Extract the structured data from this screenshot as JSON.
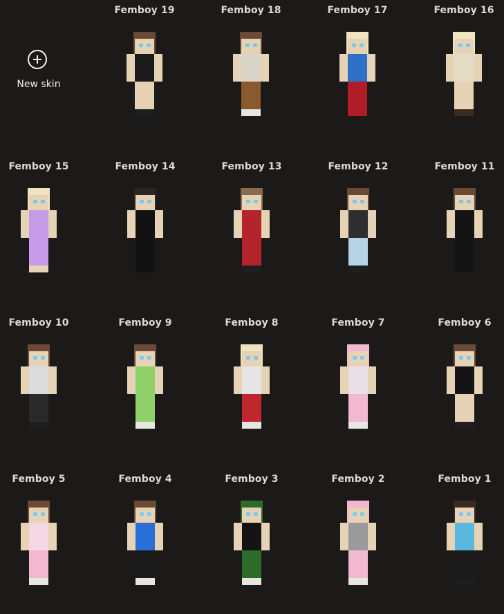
{
  "new_skin": {
    "label": "New skin",
    "icon": "plus-circle-icon"
  },
  "skins": [
    {
      "name": "Femboy 19",
      "hair": "#6b4a35",
      "skin": "#e6d2b5",
      "top": "#1b1b1b",
      "bottom": "#e6d2b5",
      "shoes": "#1e1e1e"
    },
    {
      "name": "Femboy 18",
      "hair": "#6b4a35",
      "skin": "#e6d2b5",
      "top": "#d9d6c8",
      "bottom": "#8a5a2f",
      "shoes": "#e8e6e0"
    },
    {
      "name": "Femboy 17",
      "hair": "#efe3c0",
      "skin": "#e6d2b5",
      "top": "#2f6fc8",
      "bottom": "#b11d27",
      "shoes": "#b11d27"
    },
    {
      "name": "Femboy 16",
      "hair": "#efe3c0",
      "skin": "#e6d2b5",
      "top": "#e4dcc4",
      "bottom": "#e6d2b5",
      "shoes": "#3a2a22"
    },
    {
      "name": "Femboy 15",
      "hair": "#efe3c0",
      "skin": "#e6d2b5",
      "top": "#c59ae6",
      "bottom": "#c59ae6",
      "shoes": "#e6d2b5"
    },
    {
      "name": "Femboy 14",
      "hair": "#2c2520",
      "skin": "#e6d2b5",
      "top": "#121212",
      "bottom": "#121212",
      "shoes": "#121212"
    },
    {
      "name": "Femboy 13",
      "hair": "#8a6a50",
      "skin": "#e6d2b5",
      "top": "#b3242b",
      "bottom": "#b3242b",
      "shoes": "#1e1e1e"
    },
    {
      "name": "Femboy 12",
      "hair": "#6b4a35",
      "skin": "#e6d2b5",
      "top": "#2e2e2e",
      "bottom": "#b9d3e6",
      "shoes": "#1e1e1e"
    },
    {
      "name": "Femboy 11",
      "hair": "#6b4a35",
      "skin": "#e6d2b5",
      "top": "#141414",
      "bottom": "#141414",
      "shoes": "#141414"
    },
    {
      "name": "Femboy 10",
      "hair": "#6b4a35",
      "skin": "#e6d2b5",
      "top": "#dcdcdc",
      "bottom": "#2a2a2a",
      "shoes": "#1e1e1e"
    },
    {
      "name": "Femboy 9",
      "hair": "#6b4a35",
      "skin": "#e6d2b5",
      "top": "#8fd06a",
      "bottom": "#8fd06a",
      "shoes": "#e8e6e0"
    },
    {
      "name": "Femboy 8",
      "hair": "#efe3c0",
      "skin": "#e6d2b5",
      "top": "#e6e6e6",
      "bottom": "#c0262e",
      "shoes": "#e8e6e0"
    },
    {
      "name": "Femboy 7",
      "hair": "#f2b8d0",
      "skin": "#e6d2b5",
      "top": "#e8e0e6",
      "bottom": "#f2b8d0",
      "shoes": "#e8e6e0"
    },
    {
      "name": "Femboy 6",
      "hair": "#6b4a35",
      "skin": "#e6d2b5",
      "top": "#141414",
      "bottom": "#e6d2b5",
      "shoes": "#1e1e1e"
    },
    {
      "name": "Femboy 5",
      "hair": "#6b4a35",
      "skin": "#e6d2b5",
      "top": "#f3d7e2",
      "bottom": "#f2b8d0",
      "shoes": "#e8e6e0"
    },
    {
      "name": "Femboy 4",
      "hair": "#6b4a35",
      "skin": "#e6d2b5",
      "top": "#2a6fd8",
      "bottom": "#1b1b1b",
      "shoes": "#e8e6e0"
    },
    {
      "name": "Femboy 3",
      "hair": "#2d6b2a",
      "skin": "#e6d2b5",
      "top": "#141414",
      "bottom": "#2d6b2a",
      "shoes": "#e8e6e0"
    },
    {
      "name": "Femboy 2",
      "hair": "#f2b8d0",
      "skin": "#e6d2b5",
      "top": "#9a9a9a",
      "bottom": "#f2b8d0",
      "shoes": "#e8e6e0"
    },
    {
      "name": "Femboy 1",
      "hair": "#3a2a22",
      "skin": "#e6d2b5",
      "top": "#5ab8e0",
      "bottom": "#1b1b1b",
      "shoes": "#1e1e1e"
    }
  ]
}
